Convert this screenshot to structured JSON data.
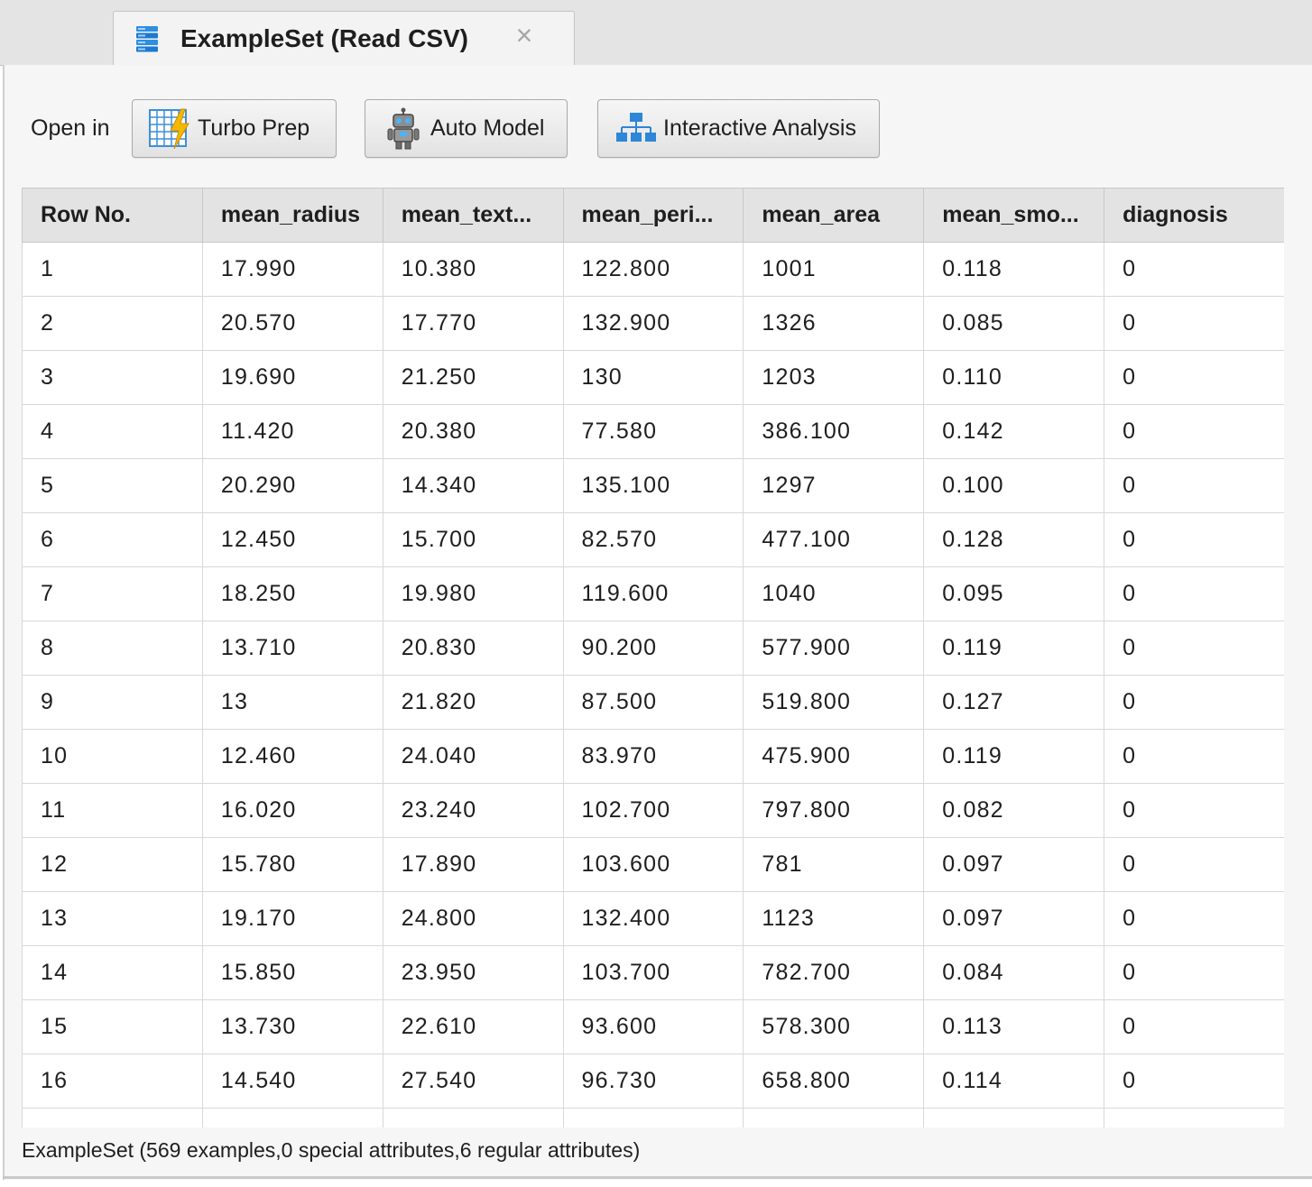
{
  "tab": {
    "title": "ExampleSet (Read CSV)",
    "close_label": "×",
    "icon": "database-icon"
  },
  "toolbar": {
    "open_in_label": "Open in",
    "buttons": [
      {
        "label": "Turbo Prep",
        "icon": "turbo-prep-icon"
      },
      {
        "label": "Auto Model",
        "icon": "robot-icon"
      },
      {
        "label": "Interactive Analysis",
        "icon": "hierarchy-icon"
      }
    ]
  },
  "table": {
    "columns": [
      "Row No.",
      "mean_radius",
      "mean_text...",
      "mean_peri...",
      "mean_area",
      "mean_smo...",
      "diagnosis"
    ],
    "rows": [
      [
        "1",
        "17.990",
        "10.380",
        "122.800",
        "1001",
        "0.118",
        "0"
      ],
      [
        "2",
        "20.570",
        "17.770",
        "132.900",
        "1326",
        "0.085",
        "0"
      ],
      [
        "3",
        "19.690",
        "21.250",
        "130",
        "1203",
        "0.110",
        "0"
      ],
      [
        "4",
        "11.420",
        "20.380",
        "77.580",
        "386.100",
        "0.142",
        "0"
      ],
      [
        "5",
        "20.290",
        "14.340",
        "135.100",
        "1297",
        "0.100",
        "0"
      ],
      [
        "6",
        "12.450",
        "15.700",
        "82.570",
        "477.100",
        "0.128",
        "0"
      ],
      [
        "7",
        "18.250",
        "19.980",
        "119.600",
        "1040",
        "0.095",
        "0"
      ],
      [
        "8",
        "13.710",
        "20.830",
        "90.200",
        "577.900",
        "0.119",
        "0"
      ],
      [
        "9",
        "13",
        "21.820",
        "87.500",
        "519.800",
        "0.127",
        "0"
      ],
      [
        "10",
        "12.460",
        "24.040",
        "83.970",
        "475.900",
        "0.119",
        "0"
      ],
      [
        "11",
        "16.020",
        "23.240",
        "102.700",
        "797.800",
        "0.082",
        "0"
      ],
      [
        "12",
        "15.780",
        "17.890",
        "103.600",
        "781",
        "0.097",
        "0"
      ],
      [
        "13",
        "19.170",
        "24.800",
        "132.400",
        "1123",
        "0.097",
        "0"
      ],
      [
        "14",
        "15.850",
        "23.950",
        "103.700",
        "782.700",
        "0.084",
        "0"
      ],
      [
        "15",
        "13.730",
        "22.610",
        "93.600",
        "578.300",
        "0.113",
        "0"
      ],
      [
        "16",
        "14.540",
        "27.540",
        "96.730",
        "658.800",
        "0.114",
        "0"
      ],
      [
        "",
        "",
        "",
        "",
        "",
        "",
        ""
      ]
    ]
  },
  "status": "ExampleSet (569 examples,0 special attributes,6 regular attributes)"
}
